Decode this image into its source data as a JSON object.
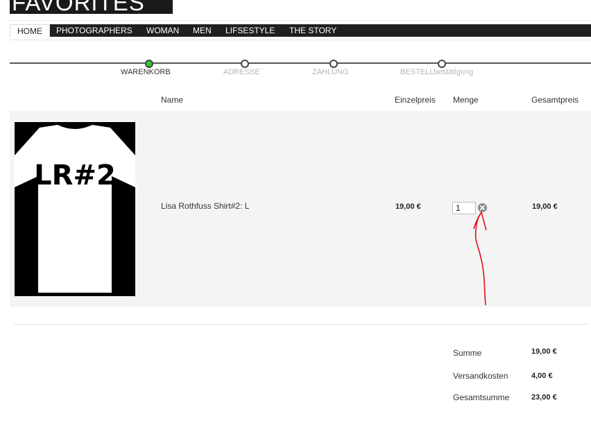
{
  "brand": {
    "logo_text": "FAVORITES"
  },
  "nav": {
    "items": [
      {
        "label": "HOME",
        "active": true
      },
      {
        "label": "PHOTOGRAPHERS"
      },
      {
        "label": "WOMAN"
      },
      {
        "label": "MEN"
      },
      {
        "label": "LIFSESTYLE"
      },
      {
        "label": "THE STORY"
      }
    ]
  },
  "steps": [
    {
      "label": "WARENKORB",
      "active": true
    },
    {
      "label": "ADRESSE"
    },
    {
      "label": "ZAHLUNG"
    },
    {
      "label": "BESTELLbestätigung"
    }
  ],
  "table": {
    "headers": {
      "name": "Name",
      "unit_price": "Einzelpreis",
      "quantity": "Menge",
      "total": "Gesamtpreis"
    },
    "rows": [
      {
        "image_text": "LR#2",
        "name": "Lisa Rothfuss Shirt#2: L",
        "unit_price": "19,00 €",
        "quantity": "1",
        "total": "19,00 €"
      }
    ]
  },
  "summary": [
    {
      "label": "Summe",
      "value": "19,00 €"
    },
    {
      "label": "Versandkosten",
      "value": "4,00 €"
    },
    {
      "label": "Gesamtsumme",
      "value": "23,00 €"
    }
  ],
  "colors": {
    "active_step": "#2ecc2e",
    "nav_bg": "#1f1f1f",
    "row_bg": "#f4f4f4",
    "annotation": "#e0101a"
  },
  "icons": {
    "remove": "close-circle-icon"
  }
}
